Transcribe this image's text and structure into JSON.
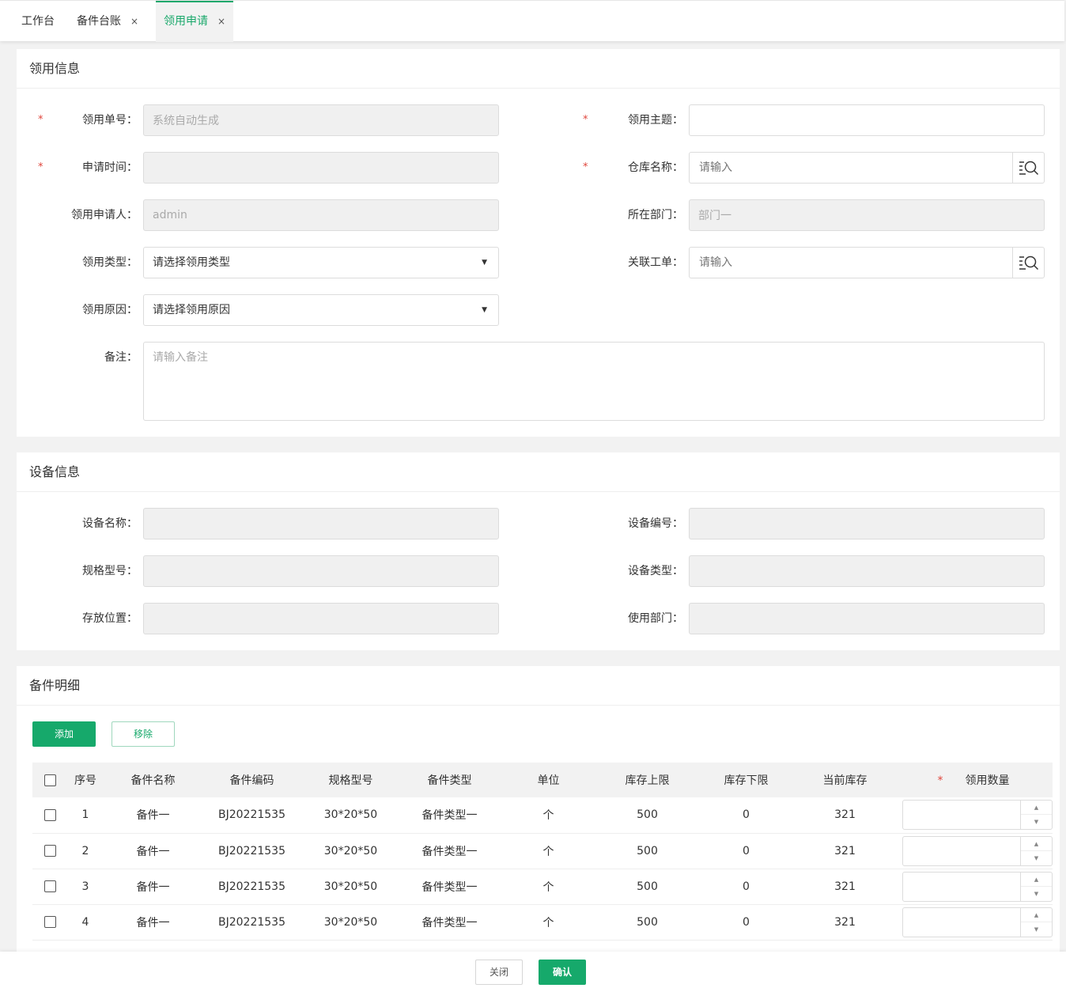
{
  "tabs": [
    {
      "label": "工作台",
      "closable": false
    },
    {
      "label": "备件台账",
      "closable": true
    },
    {
      "label": "领用申请",
      "closable": true,
      "active": true
    }
  ],
  "close_glyph": "×",
  "sections": {
    "apply_info": "领用信息",
    "device_info": "设备信息",
    "parts_detail": "备件明细"
  },
  "form": {
    "required_mark": "*",
    "order_no": {
      "label": "领用单号",
      "value": "系统自动生成"
    },
    "subject": {
      "label": "领用主题",
      "value": ""
    },
    "apply_time": {
      "label": "申请时间",
      "value": ""
    },
    "warehouse": {
      "label": "仓库名称",
      "placeholder": "请输入"
    },
    "applicant": {
      "label": "领用申请人",
      "value": "admin"
    },
    "department": {
      "label": "所在部门",
      "value": "部门一"
    },
    "apply_type": {
      "label": "领用类型",
      "value": "请选择领用类型"
    },
    "work_order": {
      "label": "关联工单",
      "placeholder": "请输入"
    },
    "apply_reason": {
      "label": "领用原因",
      "value": "请选择领用原因"
    },
    "remark": {
      "label": "备注",
      "placeholder": "请输入备注"
    }
  },
  "device": {
    "name": {
      "label": "设备名称",
      "value": ""
    },
    "code": {
      "label": "设备编号",
      "value": ""
    },
    "model": {
      "label": "规格型号",
      "value": ""
    },
    "type": {
      "label": "设备类型",
      "value": ""
    },
    "location": {
      "label": "存放位置",
      "value": ""
    },
    "dept": {
      "label": "使用部门",
      "value": ""
    }
  },
  "colon": "：",
  "actions": {
    "add": "添加",
    "remove": "移除"
  },
  "table": {
    "headers": [
      "序号",
      "备件名称",
      "备件编码",
      "规格型号",
      "备件类型",
      "单位",
      "库存上限",
      "库存下限",
      "当前库存",
      "领用数量"
    ],
    "qty_required_mark": "*",
    "rows": [
      [
        "1",
        "备件一",
        "BJ20221535",
        "30*20*50",
        "备件类型一",
        "个",
        "500",
        "0",
        "321"
      ],
      [
        "2",
        "备件一",
        "BJ20221535",
        "30*20*50",
        "备件类型一",
        "个",
        "500",
        "0",
        "321"
      ],
      [
        "3",
        "备件一",
        "BJ20221535",
        "30*20*50",
        "备件类型一",
        "个",
        "500",
        "0",
        "321"
      ],
      [
        "4",
        "备件一",
        "BJ20221535",
        "30*20*50",
        "备件类型一",
        "个",
        "500",
        "0",
        "321"
      ]
    ]
  },
  "spinner": {
    "up": "▲",
    "down": "▼"
  },
  "caret": "▼",
  "footer": {
    "close": "关闭",
    "confirm": "确认"
  },
  "colors": {
    "accent": "#16a96b",
    "required": "#e0463c"
  }
}
